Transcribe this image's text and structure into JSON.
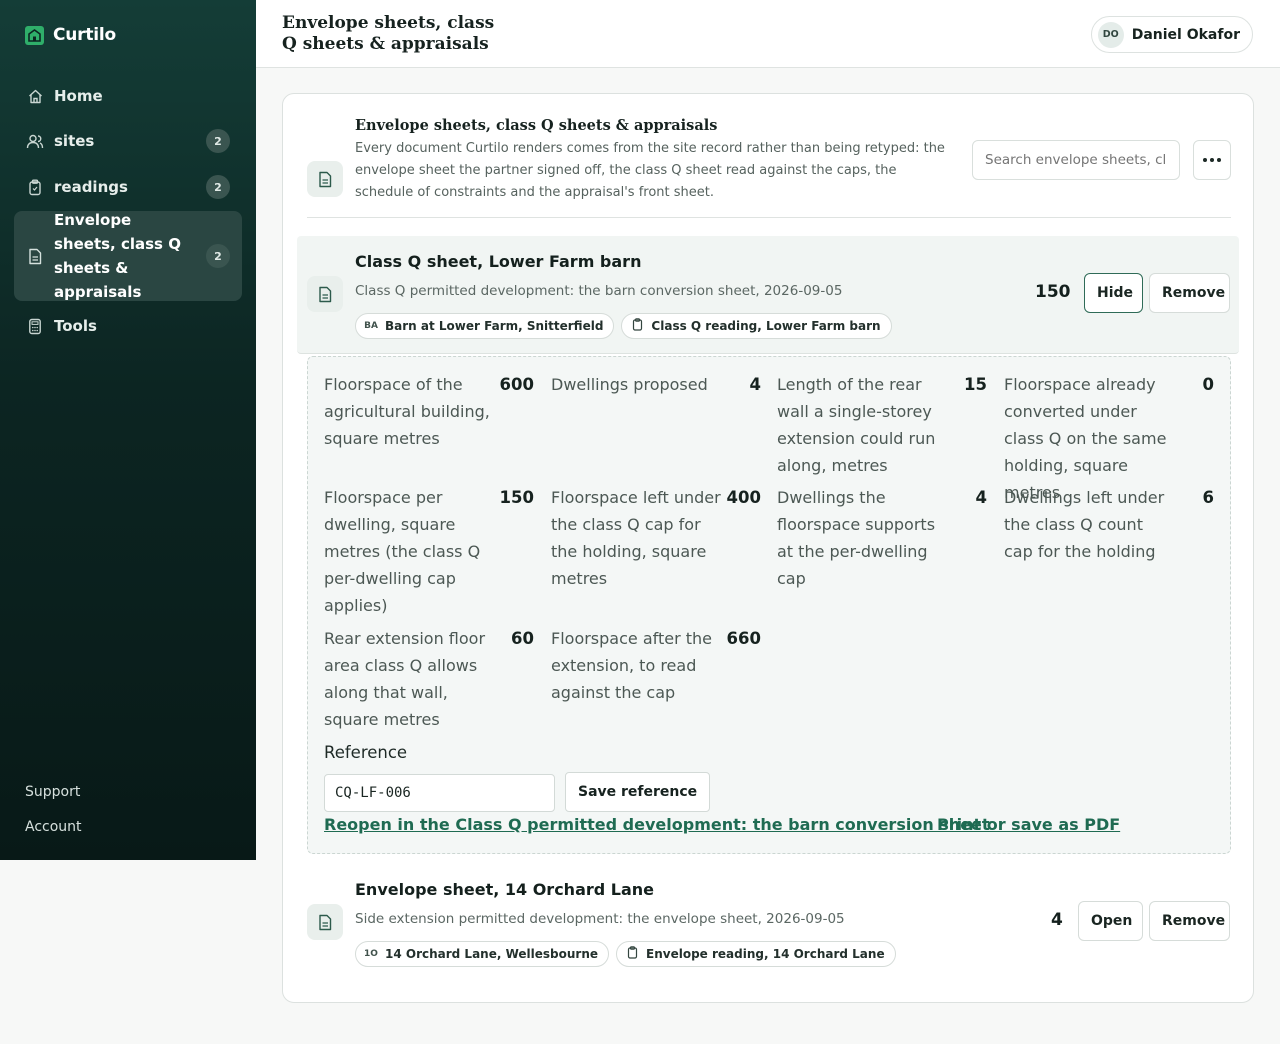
{
  "brand": {
    "name": "Curtilo"
  },
  "sidebar": {
    "items": [
      {
        "label": "Home",
        "icon": "home-icon"
      },
      {
        "label": "sites",
        "count": "2",
        "icon": "people-icon"
      },
      {
        "label": "readings",
        "count": "2",
        "icon": "clipboard-icon"
      },
      {
        "label": "Envelope sheets, class Q sheets & appraisals",
        "count": "2",
        "icon": "document-icon",
        "active": true
      },
      {
        "label": "Tools",
        "icon": "calculator-icon"
      }
    ],
    "footer": {
      "support": "Support",
      "account": "Account"
    }
  },
  "header": {
    "title": "Envelope sheets, class Q sheets & appraisals",
    "user": {
      "initials": "DO",
      "name": "Daniel Okafor"
    }
  },
  "section": {
    "title": "Envelope sheets, class Q sheets & appraisals",
    "description": "Every document Curtilo renders comes from the site record rather than being retyped: the envelope sheet the partner signed off, the class Q sheet read against the caps, the schedule of constraints and the appraisal's front sheet.",
    "search_placeholder": "Search envelope sheets, class Q sheets & appraisals"
  },
  "items": [
    {
      "title": "Class Q sheet, Lower Farm barn",
      "subtitle": "Class Q permitted development: the barn conversion sheet, 2026-09-05",
      "chip_site": {
        "initials": "BA",
        "label": "Barn at Lower Farm, Snitterfield"
      },
      "chip_reading": "Class Q reading, Lower Farm barn",
      "value": "150",
      "toggle_label": "Hide",
      "remove_label": "Remove"
    },
    {
      "title": "Envelope sheet, 14 Orchard Lane",
      "subtitle": "Side extension permitted development: the envelope sheet, 2026-09-05",
      "chip_site": {
        "initials": "1O",
        "label": "14 Orchard Lane, Wellesbourne"
      },
      "chip_reading": "Envelope reading, 14 Orchard Lane",
      "value": "4",
      "toggle_label": "Open",
      "remove_label": "Remove"
    }
  ],
  "detail": {
    "metrics": [
      {
        "label": "Floorspace of the agricultural building, square metres",
        "value": "600"
      },
      {
        "label": "Dwellings proposed",
        "value": "4"
      },
      {
        "label": "Length of the rear wall a single-storey extension could run along, metres",
        "value": "15"
      },
      {
        "label": "Floorspace already converted under class Q on the same holding, square metres",
        "value": "0"
      },
      {
        "label": "Floorspace per dwelling, square metres (the class Q per-dwelling cap applies)",
        "value": "150"
      },
      {
        "label": "Floorspace left under the class Q cap for the holding, square metres",
        "value": "400"
      },
      {
        "label": "Dwellings the floorspace supports at the per-dwelling cap",
        "value": "4"
      },
      {
        "label": "Dwellings left under the class Q count cap for the holding",
        "value": "6"
      },
      {
        "label": "Rear extension floor area class Q allows along that wall, square metres",
        "value": "60"
      },
      {
        "label": "Floorspace after the extension, to read against the cap",
        "value": "660"
      }
    ],
    "reference_label": "Reference",
    "reference_value": "CQ-LF-006",
    "save_reference": "Save reference",
    "reopen_link": "Reopen in the Class Q permitted development: the barn conversion sheet",
    "print_link": "Print or save as PDF"
  },
  "colors": {
    "sidebar_bg": "#0c2522",
    "accent": "#1f6b52",
    "brand_logo": "#2fae6a"
  }
}
